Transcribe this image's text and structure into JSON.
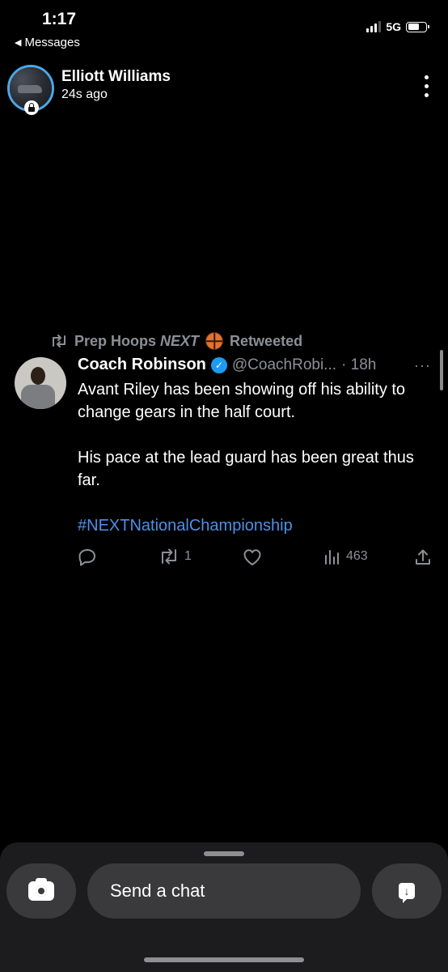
{
  "status_bar": {
    "time": "1:17",
    "back_label": "Messages",
    "network": "5G",
    "signal_bars": 3,
    "battery_level": 0.6
  },
  "header": {
    "name": "Elliott Williams",
    "subtitle": "24s ago"
  },
  "tweet": {
    "retweeted_by_pre": "Prep Hoops",
    "retweeted_by_italic": "NEXT",
    "retweeted_label": "Retweeted",
    "author_name": "Coach Robinson",
    "author_handle": "@CoachRobi...",
    "time": "· 18h",
    "more": "···",
    "text_line_1": "Avant Riley has been showing off his ability to change gears in the half court.",
    "text_line_2": "His pace at the lead guard has been great thus far.",
    "hashtag": "#NEXTNationalChampionship",
    "actions": {
      "reply_count": "",
      "retweet_count": "1",
      "like_count": "",
      "views_count": "463"
    }
  },
  "chat_bar": {
    "placeholder": "Send a chat"
  },
  "colors": {
    "background": "#000000",
    "muted_text": "#8b9096",
    "hashtag": "#4d8fe8",
    "verified": "#1d9bf0",
    "avatar_ring": "#4aa8e8",
    "panel": "#1c1c1e",
    "control": "#3a3a3c"
  },
  "icons": [
    "back-triangle-icon",
    "signal-icon",
    "battery-icon",
    "lock-icon",
    "more-vert-icon",
    "retweet-icon",
    "basketball-icon",
    "verified-icon",
    "reply-icon",
    "like-icon",
    "views-icon",
    "share-icon",
    "camera-icon",
    "chat-send-icon"
  ]
}
